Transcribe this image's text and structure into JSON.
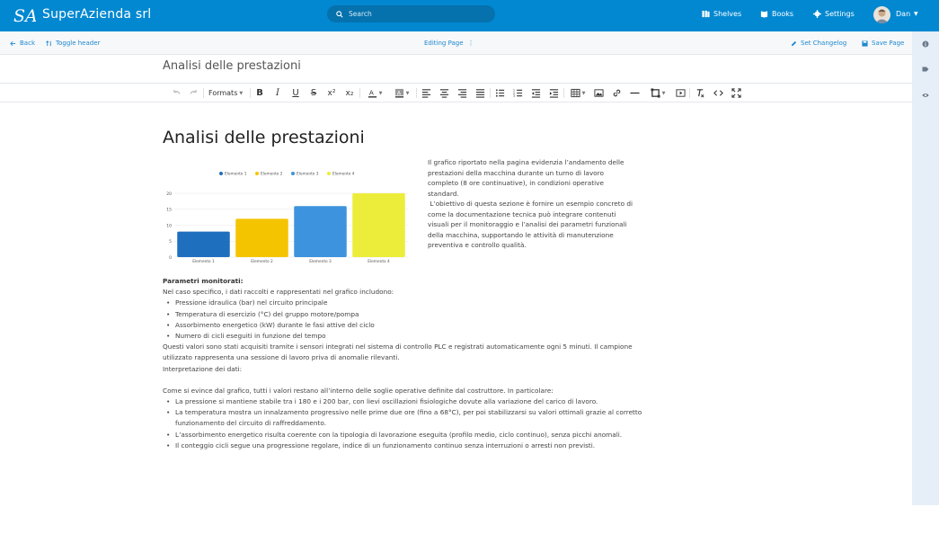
{
  "header": {
    "brand": "SuperAzienda srl",
    "logo_text": "SA",
    "search_placeholder": "Search",
    "nav": [
      {
        "label": "Shelves",
        "icon": "shelves-icon"
      },
      {
        "label": "Books",
        "icon": "book-icon"
      },
      {
        "label": "Settings",
        "icon": "gear-icon"
      }
    ],
    "user": {
      "name": "Dan"
    }
  },
  "subbar": {
    "back": "Back",
    "toggle_header": "Toggle header",
    "editing": "Editing Page",
    "set_changelog": "Set Changelog",
    "save_page": "Save Page"
  },
  "title_value": "Analisi delle prestazioni",
  "toolbar": {
    "formats": "Formats"
  },
  "content": {
    "heading": "Analisi delle prestazioni",
    "side_paragraph_1": "Il grafico riportato nella pagina evidenzia l’andamento delle prestazioni della macchina durante un turno di lavoro completo (8 ore continuative), in condizioni operative standard.",
    "side_paragraph_2": " L’obiettivo di questa sezione è fornire un esempio concreto di come la documentazione tecnica può integrare contenuti visuali per il monitoraggio e l’analisi dei parametri funzionali della macchina, supportando le attività di manutenzione preventiva e controllo qualità.",
    "params_title": "Parametri monitorati:",
    "params_intro": "Nel caso specifico, i dati raccolti e rappresentati nel grafico includono:",
    "params": [
      "Pressione idraulica (bar) nel circuito principale",
      "Temperatura di esercizio (°C) del gruppo motore/pompa",
      "Assorbimento energetico (kW) durante le fasi attive del ciclo",
      "Numero di cicli eseguiti in funzione del tempo"
    ],
    "acq_line": "Questi valori sono stati acquisiti tramite i sensori integrati nel sistema di controllo PLC e registrati automaticamente ogni 5 minuti. Il campione utilizzato rappresenta una sessione di lavoro priva di anomalie rilevanti.",
    "interp_title": "Interpretazione dei dati:",
    "interp_intro": "Come si evince dal grafico, tutti i valori restano all’interno delle soglie operative definite dal costruttore. In particolare:",
    "interp": [
      "La pressione si mantiene stabile tra i 180 e i 200 bar, con lievi oscillazioni fisiologiche dovute alla variazione del carico di lavoro.",
      "La temperatura mostra un innalzamento progressivo nelle prime due ore (fino a 68°C), per poi stabilizzarsi su valori ottimali grazie al corretto funzionamento del circuito di raffreddamento.",
      "L’assorbimento energetico risulta coerente con la tipologia di lavorazione eseguita (profilo medio, ciclo continuo), senza picchi anomali.",
      "Il conteggio cicli segue una progressione regolare, indice di un funzionamento continuo senza interruzioni o arresti non previsti."
    ]
  },
  "chart_data": {
    "type": "bar",
    "categories": [
      "Elemento 1",
      "Elemento 2",
      "Elemento 3",
      "Elemento 4"
    ],
    "series": [
      {
        "name": "Elemento 1",
        "values": [
          8
        ]
      },
      {
        "name": "Elemento 2",
        "values": [
          12
        ]
      },
      {
        "name": "Elemento 3",
        "values": [
          16
        ]
      },
      {
        "name": "Elemento 4",
        "values": [
          20
        ]
      }
    ],
    "values": [
      8,
      12,
      16,
      20
    ],
    "colors": [
      "#1f6fbf",
      "#f5c400",
      "#3d93dd",
      "#eced3a"
    ],
    "yticks": [
      0,
      5,
      10,
      15,
      20
    ],
    "ylim": [
      0,
      20
    ],
    "grid": true,
    "legend": "top"
  }
}
